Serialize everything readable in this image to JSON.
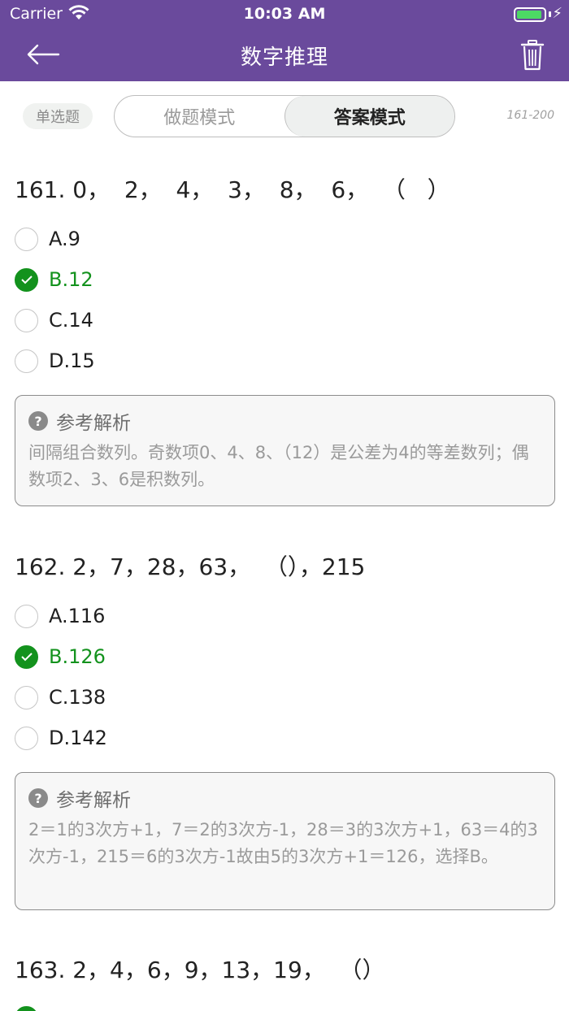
{
  "status": {
    "carrier": "Carrier",
    "time": "10:03 AM"
  },
  "nav": {
    "title": "数字推理"
  },
  "mode": {
    "type_badge": "单选题",
    "tabs": [
      "做题模式",
      "答案模式"
    ],
    "active_tab": "答案模式",
    "range": "161-200"
  },
  "colors": {
    "primary": "#6a4a9c",
    "correct": "#13921d"
  },
  "questions": [
    {
      "title": "161. 0，  2，  4，  3，  8，  6，  （   ）",
      "options": [
        {
          "label": "A.9",
          "correct": false
        },
        {
          "label": "B.12",
          "correct": true
        },
        {
          "label": "C.14",
          "correct": false
        },
        {
          "label": "D.15",
          "correct": false
        }
      ],
      "analysis_title": "参考解析",
      "analysis": "间隔组合数列。奇数项0、4、8、（12）是公差为4的等差数列；偶数项2、3、6是积数列。"
    },
    {
      "title": "162. 2，7，28，63，  （），215",
      "options": [
        {
          "label": "A.116",
          "correct": false
        },
        {
          "label": "B.126",
          "correct": true
        },
        {
          "label": "C.138",
          "correct": false
        },
        {
          "label": "D.142",
          "correct": false
        }
      ],
      "analysis_title": "参考解析",
      "analysis": "2＝1的3次方+1，7＝2的3次方-1，28＝3的3次方+1，63＝4的3次方-1，215＝6的3次方-1故由5的3次方+1＝126，选择B。"
    },
    {
      "title": "163. 2，4，6，9，13，19，  （）"
    }
  ]
}
